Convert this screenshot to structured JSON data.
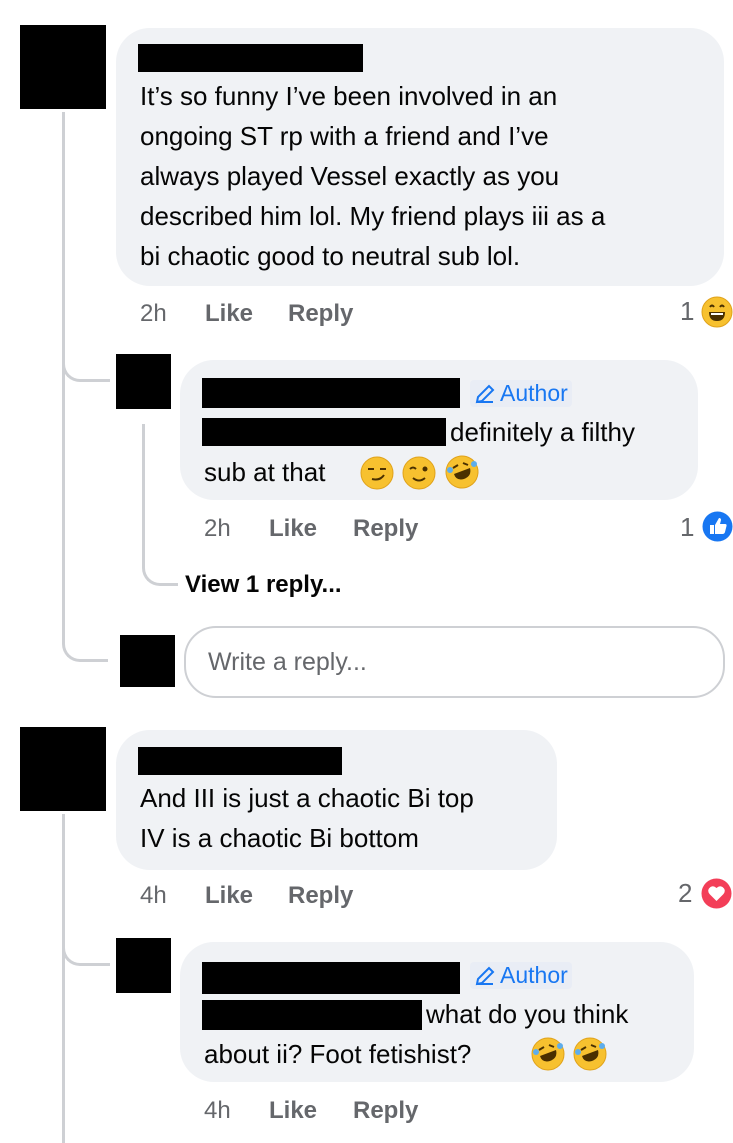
{
  "comments": [
    {
      "text_lines": [
        "It’s so funny I’ve been involved in an",
        "ongoing ST rp with a friend and I’ve",
        "always played Vessel exactly as you",
        "described him lol. My friend plays iii as  a",
        "bi chaotic good to neutral sub lol."
      ],
      "time": "2h",
      "like": "Like",
      "reply": "Reply",
      "reaction_count": "1",
      "reaction_icon": "haha-emoji-icon",
      "reply_item": {
        "author_badge": "Author",
        "line1_suffix": "definitely a filthy",
        "line2": "sub at that",
        "emojis": [
          "smirk-emoji-icon",
          "wink-emoji-icon",
          "rofl-emoji-icon"
        ],
        "time": "2h",
        "like": "Like",
        "reply": "Reply",
        "reaction_count": "1",
        "reaction_icon": "like-reaction-icon"
      },
      "view_replies": "View 1 reply...",
      "write_reply_placeholder": "Write a reply..."
    },
    {
      "text_lines": [
        "And III is just a chaotic Bi top",
        "IV is a chaotic Bi bottom"
      ],
      "time": "4h",
      "like": "Like",
      "reply": "Reply",
      "reaction_count": "2",
      "reaction_icon": "love-reaction-icon",
      "reply_item": {
        "author_badge": "Author",
        "line1_suffix": "what do you think",
        "line2": "about ii? Foot fetishist?",
        "emojis": [
          "rofl-emoji-icon",
          "rofl-emoji-icon"
        ],
        "time": "4h",
        "like": "Like",
        "reply": "Reply"
      }
    }
  ],
  "colors": {
    "bubble": "#f0f2f5",
    "meta_text": "#65676b",
    "author_blue": "#1877f2",
    "thread_line": "#ced0d4",
    "love_red": "#f33e58"
  }
}
